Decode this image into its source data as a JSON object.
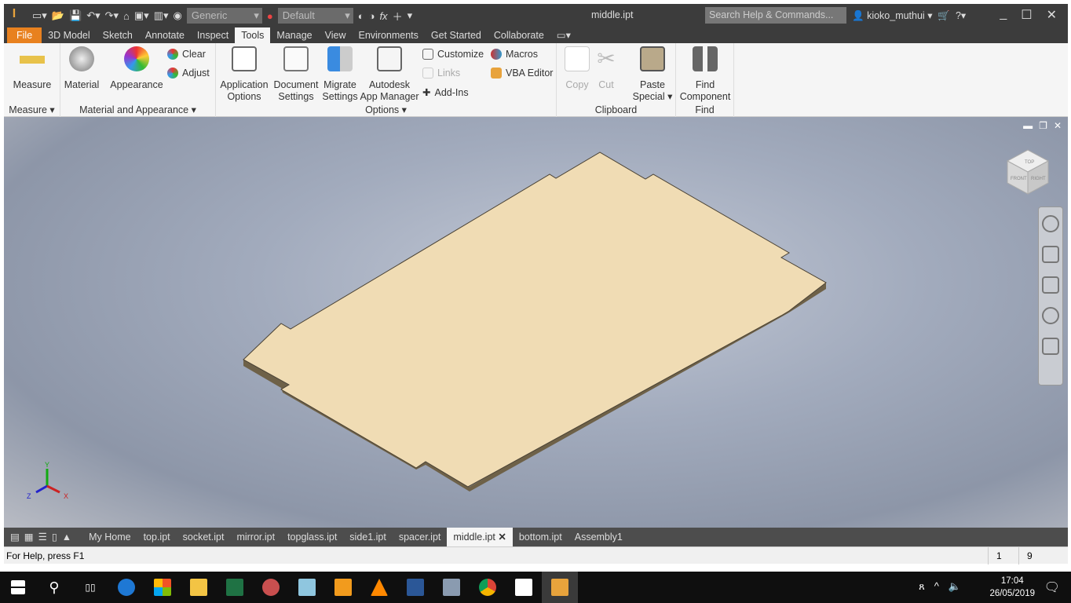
{
  "titlebar": {
    "title": "middle.ipt",
    "search_placeholder": "Search Help & Commands...",
    "user": "kioko_muthui",
    "material_combo": "Generic",
    "appearance_combo": "Default"
  },
  "ribbon_tabs": [
    "File",
    "3D Model",
    "Sketch",
    "Annotate",
    "Inspect",
    "Tools",
    "Manage",
    "View",
    "Environments",
    "Get Started",
    "Collaborate"
  ],
  "active_tab": "Tools",
  "panels": {
    "measure": {
      "title": "Measure ▾",
      "measure": "Measure"
    },
    "material": {
      "title": "Material and Appearance ▾",
      "material": "Material",
      "appearance": "Appearance",
      "clear": "Clear",
      "adjust": "Adjust"
    },
    "options": {
      "title": "Options ▾",
      "app_options": [
        "Application",
        "Options"
      ],
      "doc_settings": [
        "Document",
        "Settings"
      ],
      "migrate": [
        "Migrate",
        "Settings"
      ],
      "app_manager": [
        "Autodesk",
        "App Manager"
      ],
      "customize": "Customize",
      "links": "Links",
      "addins": "Add-Ins",
      "macros": "Macros",
      "vba": "VBA Editor"
    },
    "clipboard": {
      "title": "Clipboard",
      "copy": "Copy",
      "cut": "Cut",
      "paste": [
        "Paste",
        "Special"
      ]
    },
    "find": {
      "title": "Find",
      "find": [
        "Find",
        "Component"
      ]
    }
  },
  "doc_tabs": [
    "My Home",
    "top.ipt",
    "socket.ipt",
    "mirror.ipt",
    "topglass.ipt",
    "side1.ipt",
    "spacer.ipt",
    "middle.ipt",
    "bottom.ipt",
    "Assembly1"
  ],
  "active_doc": "middle.ipt",
  "status": {
    "help": "For Help, press F1",
    "n1": "1",
    "n2": "9"
  },
  "viewcube": {
    "top": "TOP",
    "front": "FRONT",
    "right": "RIGHT"
  },
  "axes": {
    "x": "X",
    "y": "Y",
    "z": "Z"
  },
  "taskbar": {
    "time": "17:04",
    "date": "26/05/2019"
  },
  "colors": {
    "accent": "#e8811f",
    "plate": "#f0dcb4",
    "plate_edge": "#c9b48a"
  }
}
